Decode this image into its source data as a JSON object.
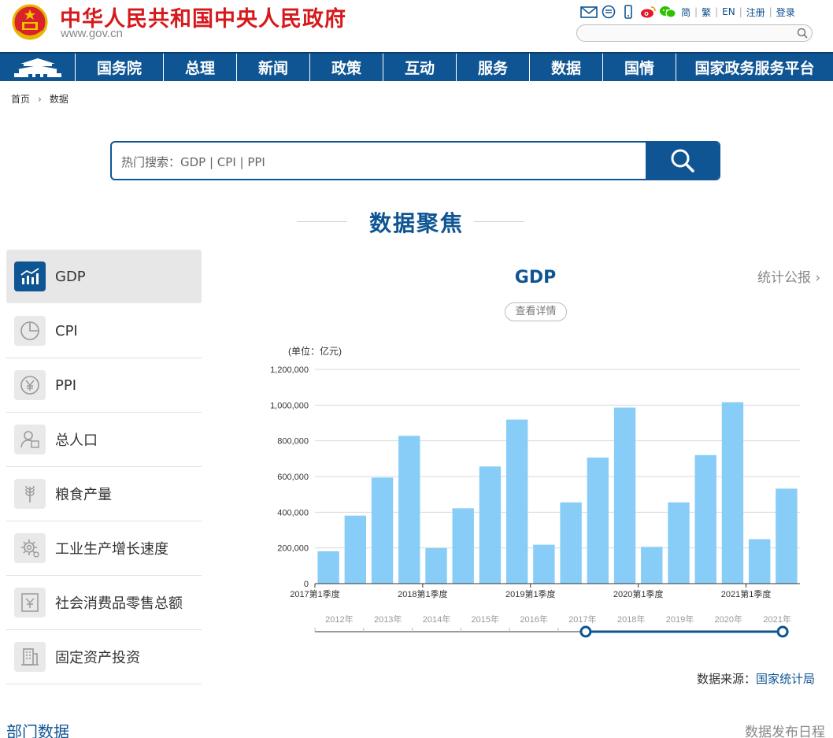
{
  "header": {
    "title": "中华人民共和国中央人民政府",
    "domain": "www.gov.cn",
    "util_icons": [
      "mail-icon",
      "message-icon",
      "mobile-icon",
      "weibo-icon",
      "wechat-icon"
    ],
    "util_links": [
      "简",
      "繁",
      "EN",
      "注册",
      "登录"
    ]
  },
  "nav": {
    "items": [
      "国务院",
      "总理",
      "新闻",
      "政策",
      "互动",
      "服务",
      "数据",
      "国情",
      "国家政务服务平台"
    ]
  },
  "breadcrumb": {
    "home": "首页",
    "current": "数据"
  },
  "search": {
    "placeholder": "热门搜索：GDP   |   CPI   |   PPI"
  },
  "section": {
    "title": "数据聚焦"
  },
  "sidebar": {
    "items": [
      {
        "label": "GDP",
        "icon": "chart-icon",
        "active": true
      },
      {
        "label": "CPI",
        "icon": "pie-icon",
        "active": false
      },
      {
        "label": "PPI",
        "icon": "yuan-icon",
        "active": false
      },
      {
        "label": "总人口",
        "icon": "person-icon",
        "active": false
      },
      {
        "label": "粮食产量",
        "icon": "grain-icon",
        "active": false
      },
      {
        "label": "工业生产增长速度",
        "icon": "gear-icon",
        "active": false
      },
      {
        "label": "社会消费品零售总额",
        "icon": "retail-icon",
        "active": false
      },
      {
        "label": "固定资产投资",
        "icon": "building-icon",
        "active": false
      }
    ]
  },
  "chart_panel": {
    "title": "GDP",
    "stat_link": "统计公报",
    "detail_button": "查看详情",
    "source_label": "数据来源：",
    "source_org": "国家统计局"
  },
  "chart_data": {
    "type": "bar",
    "unit_label": "(单位：亿元)",
    "ylim": [
      0,
      1200000
    ],
    "yticks": [
      "1,200,000",
      "1,000,000",
      "800,000",
      "600,000",
      "400,000",
      "200,000",
      "0"
    ],
    "ytick_values": [
      1200000,
      1000000,
      800000,
      600000,
      400000,
      200000,
      0
    ],
    "categories": [
      "2017Q1",
      "2017Q2",
      "2017Q3",
      "2017Q4",
      "2018Q1",
      "2018Q2",
      "2018Q3",
      "2018Q4",
      "2019Q1",
      "2019Q2",
      "2019Q3",
      "2019Q4",
      "2020Q1",
      "2020Q2",
      "2020Q3",
      "2020Q4",
      "2021Q1",
      "2021Q2"
    ],
    "values": [
      181000,
      381000,
      594000,
      828000,
      199000,
      422000,
      656000,
      919000,
      218000,
      455000,
      706000,
      986000,
      206000,
      455000,
      720000,
      1016000,
      249000,
      532000
    ],
    "x_tick_labels": [
      {
        "index": 0,
        "label": "2017第1季度"
      },
      {
        "index": 4,
        "label": "2018第1季度"
      },
      {
        "index": 8,
        "label": "2019第1季度"
      },
      {
        "index": 12,
        "label": "2020第1季度"
      },
      {
        "index": 16,
        "label": "2021第1季度"
      }
    ],
    "bar_color": "#87cdf7",
    "grid": true,
    "slider": {
      "years": [
        "2012年",
        "2013年",
        "2014年",
        "2015年",
        "2016年",
        "2017年",
        "2018年",
        "2019年",
        "2020年",
        "2021年"
      ],
      "selected_start": "2017年",
      "selected_end": "2021年"
    }
  },
  "footer": {
    "left": "部门数据",
    "right": "数据发布日程"
  }
}
